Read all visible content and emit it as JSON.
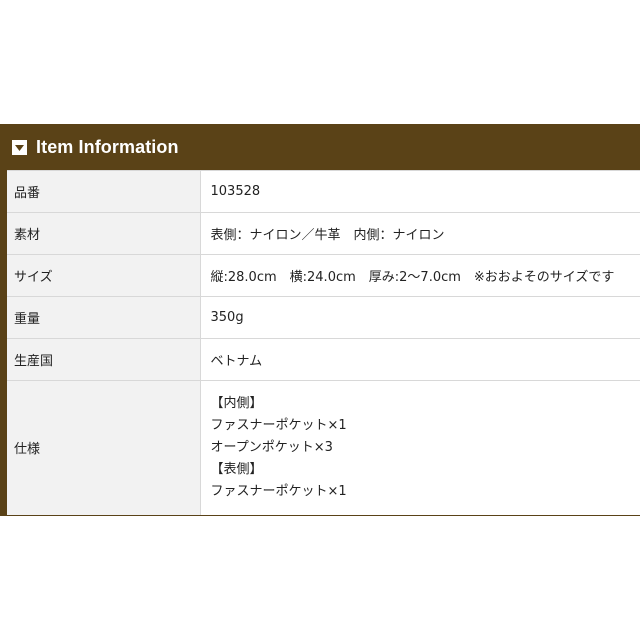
{
  "header": {
    "title": "Item Information"
  },
  "rows": [
    {
      "label": "品番",
      "value": "103528"
    },
    {
      "label": "素材",
      "value": "表側：ナイロン／牛革　内側：ナイロン"
    },
    {
      "label": "サイズ",
      "value": "縦:28.0cm　横:24.0cm　厚み:2〜7.0cm　※おおよそのサイズです"
    },
    {
      "label": "重量",
      "value": "350g"
    },
    {
      "label": "生産国",
      "value": "ベトナム"
    },
    {
      "label": "仕様",
      "lines": [
        "【内側】",
        "ファスナーポケット×1",
        "オープンポケット×3",
        "【表側】",
        "ファスナーポケット×1"
      ]
    }
  ],
  "colors": {
    "header_bg": "#5a4217",
    "label_bg": "#f2f2f2",
    "border": "#d8d8d8"
  },
  "icons": {
    "header": "caret-down-square-icon"
  }
}
